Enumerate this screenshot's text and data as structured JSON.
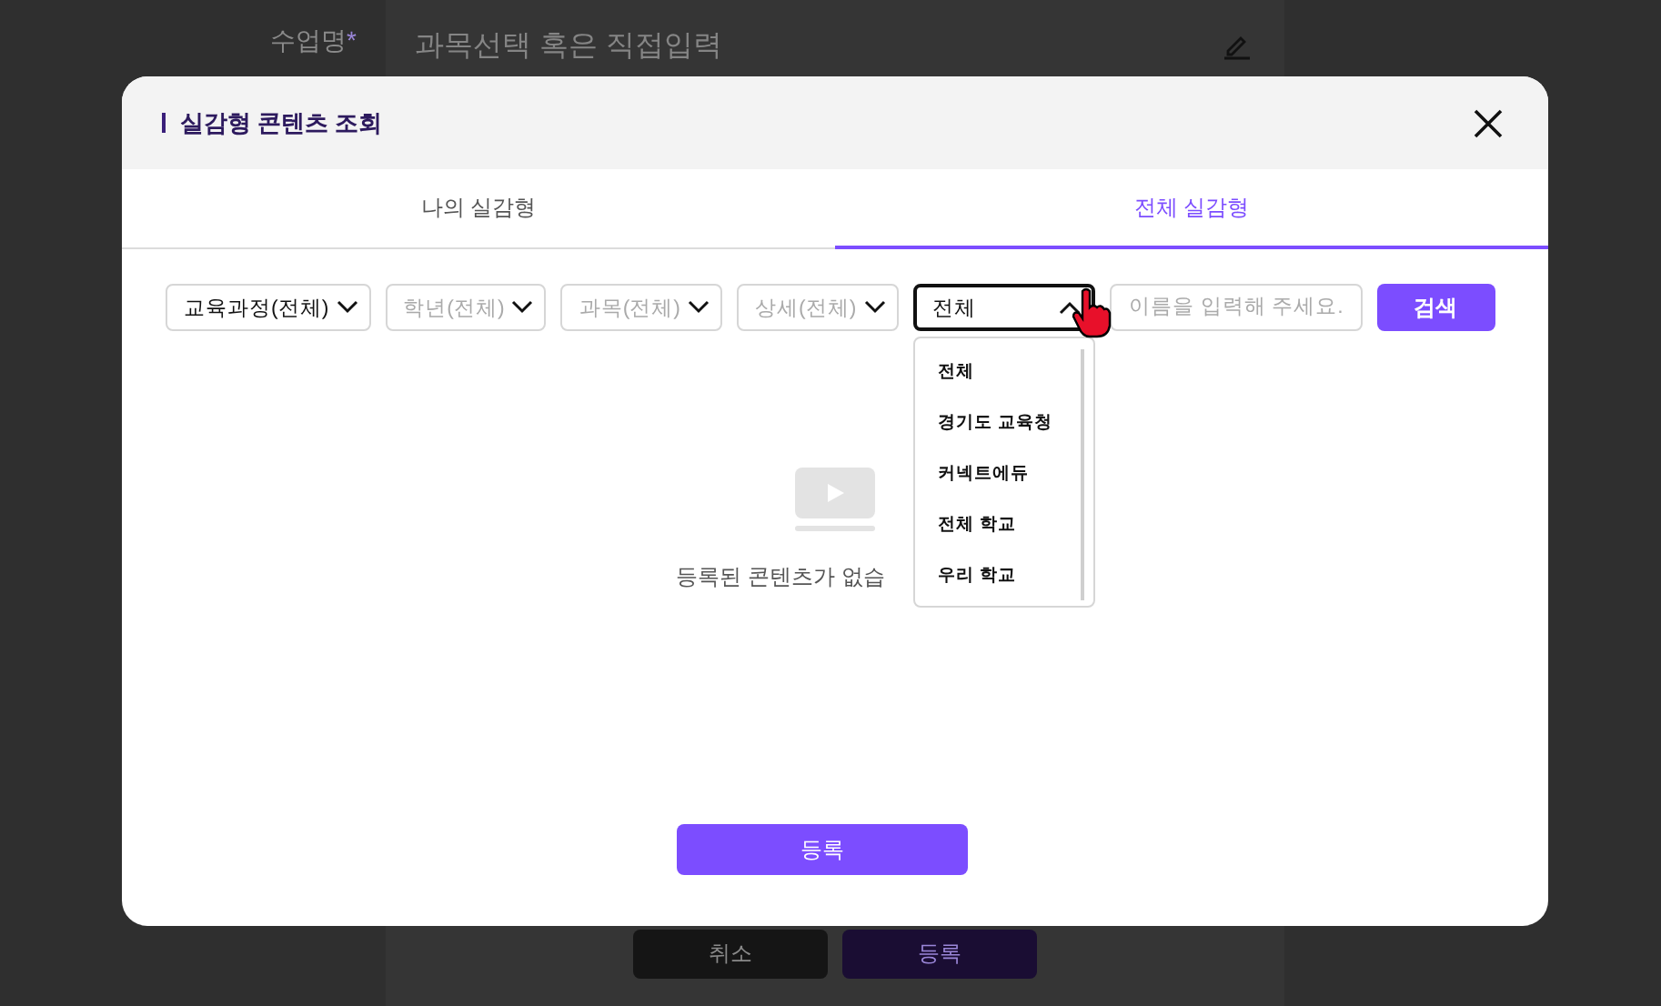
{
  "background": {
    "field_label": "수업명",
    "required_mark": "*",
    "field": {
      "placeholder": "과목선택 혹은 직접입력"
    },
    "buttons": [
      {
        "label": "취소",
        "kind": "secondary"
      },
      {
        "label": "등록",
        "kind": "primary"
      }
    ]
  },
  "dialog": {
    "title": "실감형 콘텐츠 조회",
    "tabs": [
      {
        "label": "나의 실감형",
        "selected": false
      },
      {
        "label": "전체 실감형",
        "selected": true
      }
    ],
    "filters": [
      {
        "kind": "select",
        "value": "교육과정(전체)",
        "expanded": false
      },
      {
        "kind": "select",
        "placeholder": "학년(전체)",
        "expanded": false
      },
      {
        "kind": "select",
        "placeholder": "과목(전체)",
        "expanded": false
      },
      {
        "kind": "select",
        "placeholder": "상세(전체)",
        "expanded": false
      },
      {
        "kind": "select",
        "value": "전체",
        "expanded": true,
        "options": [
          "전체",
          "경기도 교육청",
          "커넥트에듀",
          "전체 학교",
          "우리 학교"
        ]
      },
      {
        "kind": "input",
        "placeholder": "이름을 입력해 주세요."
      }
    ],
    "search_button": "검색",
    "empty_message": "등록된 콘텐츠가 없습",
    "submit_button": "등록"
  }
}
